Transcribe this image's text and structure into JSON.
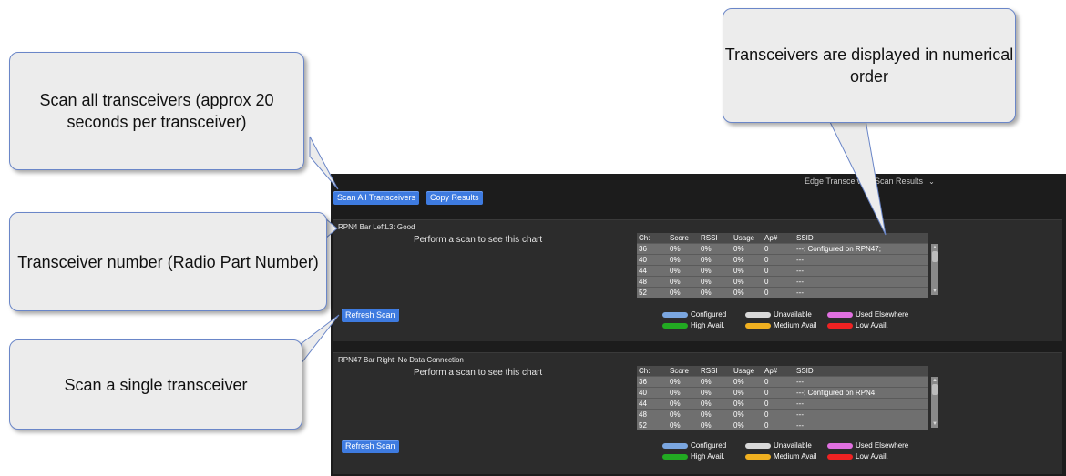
{
  "app": {
    "title": "Edge Transceivers Scan Results",
    "scan_all_label": "Scan All Transceivers",
    "copy_label": "Copy Results",
    "colors": {
      "button": "#3e7be0",
      "background": "#1c1c1c",
      "card": "#2c2c2c"
    }
  },
  "table_headers": [
    "Ch:",
    "Score",
    "RSSI",
    "Usage",
    "Ap#",
    "SSID"
  ],
  "legend": {
    "configured": "Configured",
    "unavailable": "Unavailable",
    "used_elsewhere": "Used Elsewhere",
    "high": "High Avail.",
    "medium": "Medium Avail",
    "low": "Low Avail.",
    "colors": {
      "configured": "#7aa6e0",
      "unavailable": "#d8d8d8",
      "used_elsewhere": "#e070e0",
      "high": "#22aa22",
      "medium": "#f0b020",
      "low": "#ee2222"
    }
  },
  "transceivers": [
    {
      "title": "RPN4  Bar LeftL3: Good",
      "placeholder": "Perform a scan to see this chart",
      "refresh_label": "Refresh Scan",
      "rows": [
        [
          "36",
          "0%",
          "0%",
          "0%",
          "0",
          "---; Configured on RPN47;"
        ],
        [
          "40",
          "0%",
          "0%",
          "0%",
          "0",
          "---"
        ],
        [
          "44",
          "0%",
          "0%",
          "0%",
          "0",
          "---"
        ],
        [
          "48",
          "0%",
          "0%",
          "0%",
          "0",
          "---"
        ],
        [
          "52",
          "0%",
          "0%",
          "0%",
          "0",
          "---"
        ]
      ]
    },
    {
      "title": "RPN47  Bar Right: No Data Connection",
      "placeholder": "Perform a scan to see this chart",
      "refresh_label": "Refresh Scan",
      "rows": [
        [
          "36",
          "0%",
          "0%",
          "0%",
          "0",
          "---"
        ],
        [
          "40",
          "0%",
          "0%",
          "0%",
          "0",
          "---; Configured on RPN4;"
        ],
        [
          "44",
          "0%",
          "0%",
          "0%",
          "0",
          "---"
        ],
        [
          "48",
          "0%",
          "0%",
          "0%",
          "0",
          "---"
        ],
        [
          "52",
          "0%",
          "0%",
          "0%",
          "0",
          "---"
        ]
      ]
    }
  ],
  "callouts": {
    "scan_all": "Scan all transceivers (approx 20 seconds per transceiver)",
    "order": "Transceivers are displayed in numerical order",
    "rpn": "Transceiver number (Radio Part Number)",
    "single": "Scan a single transceiver"
  }
}
